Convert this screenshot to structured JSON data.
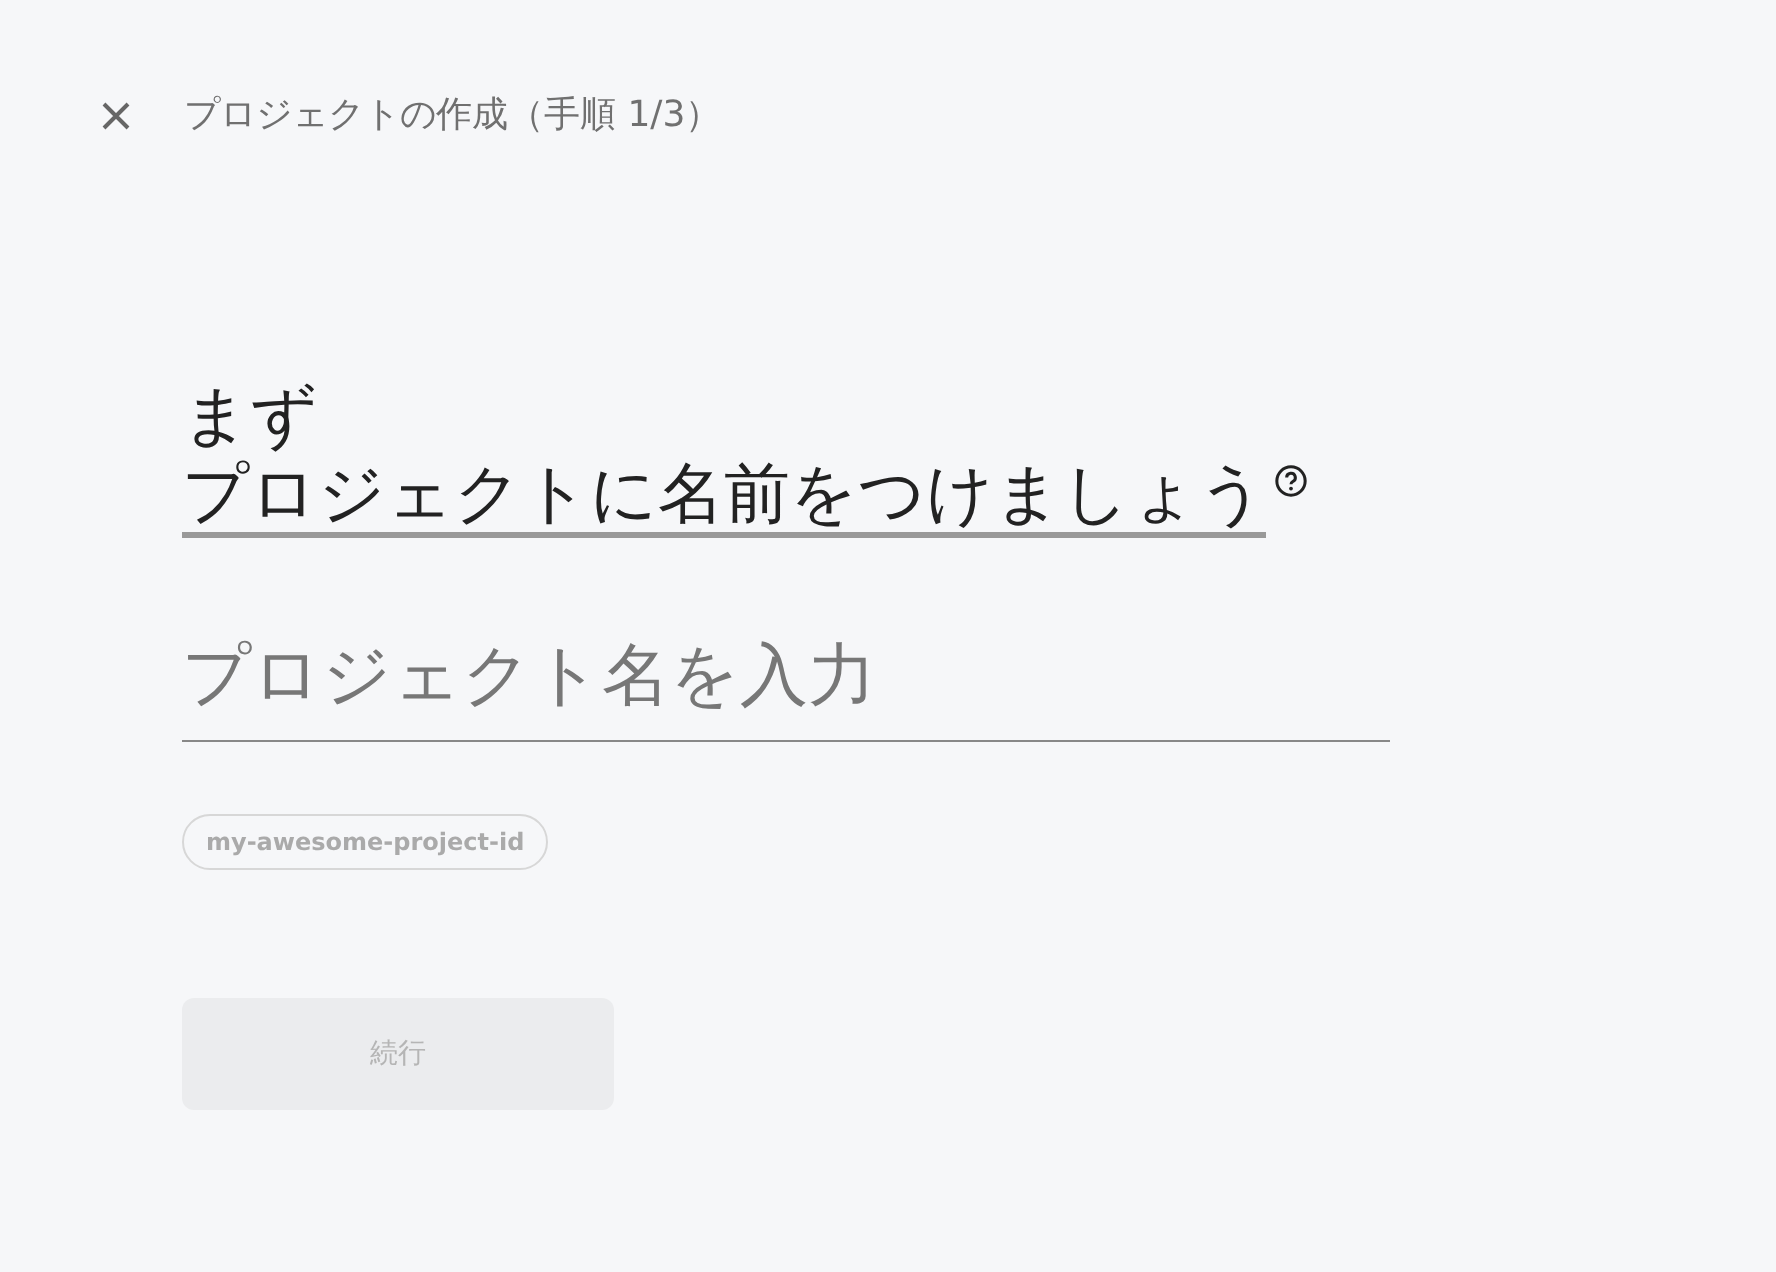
{
  "header": {
    "title": "プロジェクトの作成（手順 1/3）"
  },
  "heading": {
    "line_1": "まず",
    "line_2": "プロジェクトに名前をつけましょう"
  },
  "name_field": {
    "placeholder": "プロジェクト名を入力"
  },
  "project_id_chip": "my-awesome-project-id",
  "continue_button": {
    "label": "続行",
    "disabled": true
  }
}
